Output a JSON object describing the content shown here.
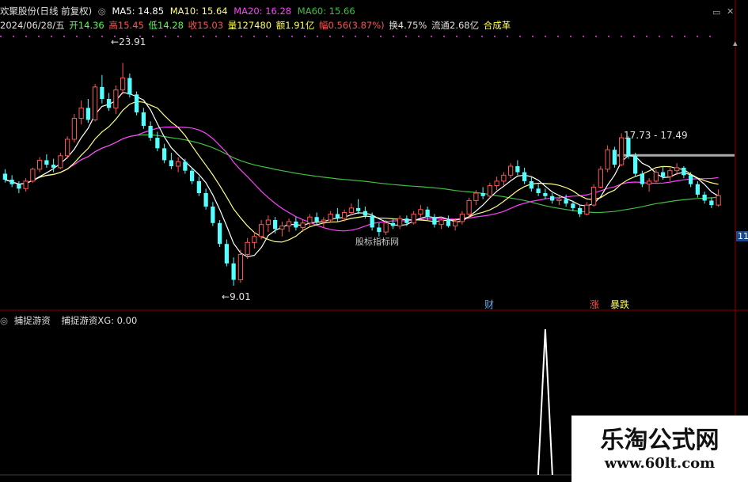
{
  "header": {
    "stock_title": "欢聚股份(日线 前复权)",
    "ma5": "MA5: 14.85",
    "ma10": "MA10: 15.64",
    "ma20": "MA20: 16.28",
    "ma60": "MA60: 15.66",
    "date": "2024/06/28/五",
    "open": "开14.36",
    "high": "高15.45",
    "low": "低14.28",
    "close": "收15.03",
    "volume": "量127480",
    "amount": "额1.91亿",
    "change": "幅0.56(3.87%)",
    "turnover": "换4.75%",
    "float": "流通2.68亿",
    "adj": "合成革"
  },
  "indicator": {
    "name": "捕捉游资",
    "value_label": "捕捉游资XG: 0.00"
  },
  "annotations": {
    "high_label": "23.91",
    "low_label": "9.01",
    "range_label": "17.73 - 17.49",
    "center_label": "股标指标网",
    "right_edge_label": "11",
    "tag_cai": "财",
    "tag_zhang": "涨",
    "tag_baodie": "暴跌"
  },
  "watermark": {
    "title": "乐淘公式网",
    "url": "www.60lt.com"
  },
  "colors": {
    "up": "#ff5454",
    "down": "#54ffff",
    "ma5": "#ffffff",
    "ma10": "#ffff80",
    "ma20": "#ff40ff",
    "ma60": "#40c040",
    "grid": "#8b0000",
    "indicator": "#ffffff"
  },
  "chart_data": [
    {
      "type": "candlestick",
      "title": "欢聚股份(日线 前复权)",
      "ylim": [
        8,
        26
      ],
      "candles_ohlc": [
        [
          16.5,
          16.8,
          15.9,
          16.1
        ],
        [
          16.1,
          16.4,
          15.6,
          15.8
        ],
        [
          15.8,
          16.0,
          15.2,
          15.5
        ],
        [
          15.5,
          16.2,
          15.3,
          16.0
        ],
        [
          16.0,
          16.9,
          15.9,
          16.8
        ],
        [
          16.8,
          17.6,
          16.6,
          17.4
        ],
        [
          17.4,
          17.8,
          16.9,
          17.1
        ],
        [
          17.1,
          17.5,
          16.6,
          16.9
        ],
        [
          16.9,
          17.9,
          16.8,
          17.7
        ],
        [
          17.7,
          19.0,
          17.5,
          18.8
        ],
        [
          18.8,
          20.5,
          18.6,
          20.2
        ],
        [
          20.2,
          21.4,
          19.8,
          20.9
        ],
        [
          20.9,
          21.5,
          19.9,
          20.1
        ],
        [
          20.1,
          22.5,
          20.0,
          22.3
        ],
        [
          22.3,
          23.1,
          21.2,
          21.5
        ],
        [
          21.5,
          21.9,
          20.7,
          20.9
        ],
        [
          20.9,
          22.4,
          20.5,
          22.1
        ],
        [
          22.1,
          23.91,
          21.8,
          22.9
        ],
        [
          22.9,
          23.2,
          21.6,
          21.8
        ],
        [
          21.8,
          22.0,
          20.4,
          20.6
        ],
        [
          20.6,
          20.9,
          19.5,
          19.7
        ],
        [
          19.7,
          20.0,
          18.7,
          18.9
        ],
        [
          18.9,
          19.3,
          18.0,
          18.2
        ],
        [
          18.2,
          18.5,
          17.2,
          17.4
        ],
        [
          17.4,
          17.9,
          16.8,
          17.0
        ],
        [
          17.0,
          17.6,
          16.6,
          17.3
        ],
        [
          17.3,
          17.5,
          16.5,
          16.7
        ],
        [
          16.7,
          16.9,
          15.8,
          16.0
        ],
        [
          16.0,
          16.3,
          15.0,
          15.2
        ],
        [
          15.2,
          15.5,
          14.1,
          14.3
        ],
        [
          14.3,
          14.6,
          13.0,
          13.2
        ],
        [
          13.2,
          13.4,
          11.6,
          11.8
        ],
        [
          11.8,
          12.1,
          10.3,
          10.5
        ],
        [
          10.5,
          10.9,
          9.01,
          9.4
        ],
        [
          9.4,
          11.4,
          9.2,
          11.1
        ],
        [
          11.1,
          12.2,
          10.8,
          11.9
        ],
        [
          11.9,
          12.6,
          11.5,
          12.3
        ],
        [
          12.3,
          13.4,
          12.1,
          13.1
        ],
        [
          13.1,
          13.7,
          12.6,
          13.4
        ],
        [
          13.4,
          13.6,
          12.5,
          12.8
        ],
        [
          12.8,
          13.3,
          12.3,
          13.0
        ],
        [
          13.0,
          13.5,
          12.6,
          13.3
        ],
        [
          13.3,
          13.6,
          12.7,
          12.9
        ],
        [
          12.9,
          13.4,
          12.6,
          13.2
        ],
        [
          13.2,
          13.8,
          13.0,
          13.6
        ],
        [
          13.6,
          13.9,
          13.1,
          13.3
        ],
        [
          13.3,
          13.6,
          12.9,
          13.4
        ],
        [
          13.4,
          14.0,
          13.2,
          13.8
        ],
        [
          13.8,
          14.2,
          13.3,
          13.5
        ],
        [
          13.5,
          14.1,
          13.3,
          13.9
        ],
        [
          13.9,
          14.5,
          13.7,
          14.2
        ],
        [
          14.2,
          14.8,
          13.8,
          14.0
        ],
        [
          14.0,
          14.3,
          13.5,
          13.7
        ],
        [
          13.7,
          13.9,
          12.7,
          12.9
        ],
        [
          12.9,
          13.2,
          12.3,
          12.6
        ],
        [
          12.6,
          13.4,
          12.4,
          13.2
        ],
        [
          13.2,
          13.5,
          12.8,
          13.0
        ],
        [
          13.0,
          13.7,
          12.8,
          13.5
        ],
        [
          13.5,
          13.7,
          13.0,
          13.2
        ],
        [
          13.2,
          14.0,
          13.1,
          13.8
        ],
        [
          13.8,
          14.4,
          13.6,
          14.1
        ],
        [
          14.1,
          14.3,
          13.4,
          13.6
        ],
        [
          13.6,
          13.8,
          12.9,
          13.1
        ],
        [
          13.1,
          13.6,
          12.8,
          13.4
        ],
        [
          13.4,
          13.7,
          12.9,
          13.0
        ],
        [
          13.0,
          13.5,
          12.7,
          13.3
        ],
        [
          13.3,
          14.0,
          13.1,
          13.8
        ],
        [
          13.8,
          14.9,
          13.6,
          14.7
        ],
        [
          14.7,
          15.4,
          14.4,
          15.2
        ],
        [
          15.2,
          15.6,
          14.8,
          15.0
        ],
        [
          15.0,
          15.9,
          14.9,
          15.7
        ],
        [
          15.7,
          16.3,
          15.4,
          16.0
        ],
        [
          16.0,
          16.6,
          15.7,
          16.4
        ],
        [
          16.4,
          17.2,
          16.2,
          17.0
        ],
        [
          17.0,
          17.4,
          16.4,
          16.6
        ],
        [
          16.6,
          16.9,
          15.8,
          16.0
        ],
        [
          16.0,
          16.3,
          15.3,
          15.5
        ],
        [
          15.5,
          15.8,
          15.0,
          15.2
        ],
        [
          15.2,
          15.5,
          14.8,
          15.0
        ],
        [
          15.0,
          15.2,
          14.5,
          14.7
        ],
        [
          14.7,
          15.0,
          14.4,
          14.8
        ],
        [
          14.8,
          15.1,
          14.3,
          14.5
        ],
        [
          14.5,
          14.7,
          14.0,
          14.2
        ],
        [
          14.2,
          14.4,
          13.6,
          13.8
        ],
        [
          13.8,
          14.6,
          13.7,
          14.4
        ],
        [
          14.4,
          15.8,
          14.3,
          15.6
        ],
        [
          15.6,
          17.0,
          15.5,
          16.8
        ],
        [
          16.8,
          18.4,
          16.6,
          18.1
        ],
        [
          18.1,
          18.3,
          16.9,
          17.1
        ],
        [
          17.1,
          19.2,
          17.0,
          18.9
        ],
        [
          18.9,
          19.0,
          17.5,
          17.7
        ],
        [
          17.7,
          17.9,
          16.3,
          16.5
        ],
        [
          16.5,
          16.7,
          15.6,
          15.8
        ],
        [
          15.8,
          16.2,
          15.3,
          16.0
        ],
        [
          16.0,
          16.8,
          15.9,
          16.6
        ],
        [
          16.6,
          17.0,
          16.1,
          16.3
        ],
        [
          16.3,
          16.9,
          16.0,
          16.7
        ],
        [
          16.7,
          17.2,
          16.4,
          16.9
        ],
        [
          16.9,
          17.0,
          16.2,
          16.4
        ],
        [
          16.4,
          16.6,
          15.6,
          15.8
        ],
        [
          15.8,
          16.0,
          14.9,
          15.1
        ],
        [
          15.1,
          15.3,
          14.5,
          14.7
        ],
        [
          14.7,
          14.9,
          14.2,
          14.4
        ],
        [
          14.4,
          15.45,
          14.28,
          15.03
        ]
      ],
      "ma_current": {
        "MA5": 14.85,
        "MA10": 15.64,
        "MA20": 16.28,
        "MA60": 15.66
      },
      "annotated_high": 23.91,
      "annotated_low": 9.01,
      "annotated_range": [
        17.73,
        17.49
      ]
    },
    {
      "type": "line",
      "title": "捕捉游资",
      "series": [
        {
          "name": "捕捉游资XG",
          "spike_index": 78,
          "spike_value": 1,
          "current": 0.0
        }
      ]
    }
  ]
}
